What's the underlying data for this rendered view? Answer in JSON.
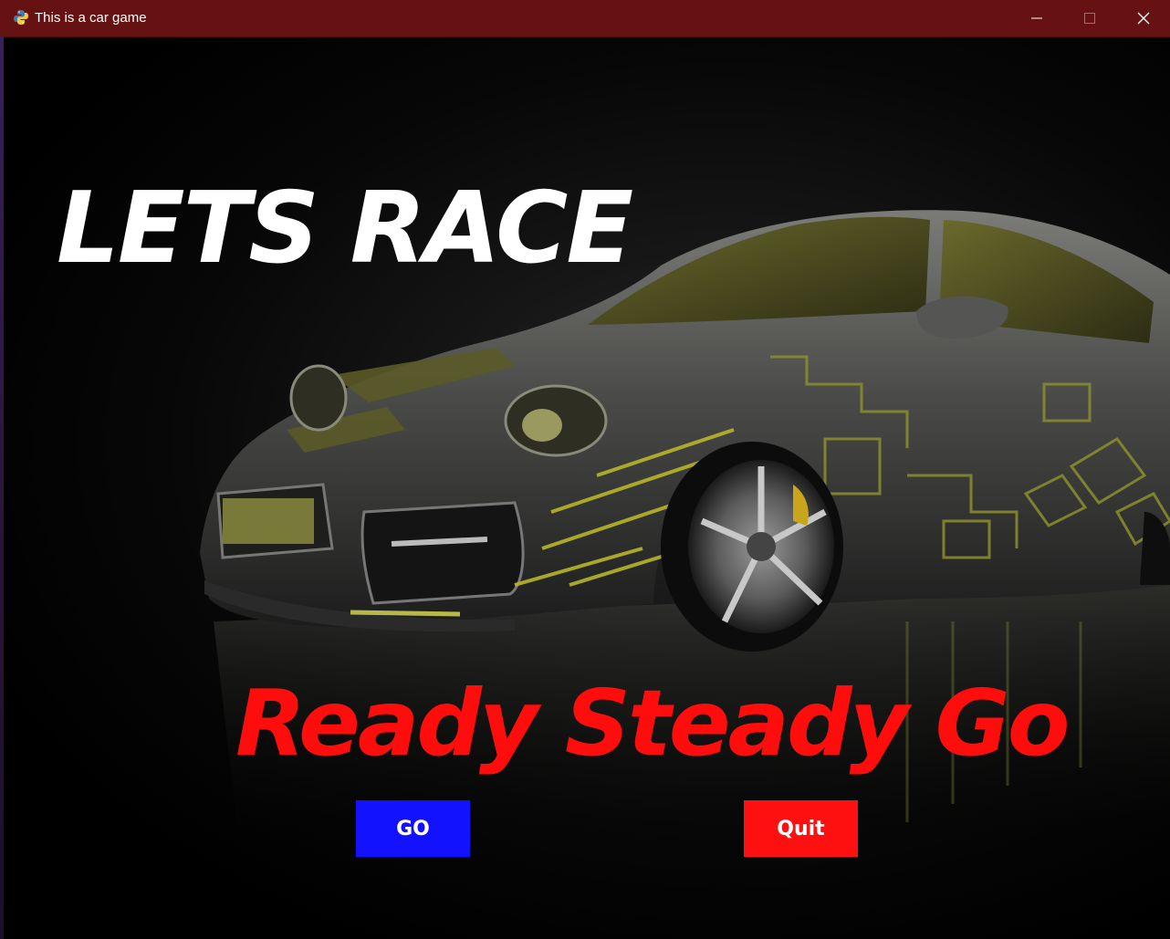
{
  "window": {
    "title": "This is a car game",
    "titlebar_color": "#661212",
    "app_icon": "python-icon",
    "controls": [
      "minimize-icon",
      "maximize-icon",
      "close-icon"
    ]
  },
  "game": {
    "headline": "LETS RACE",
    "headline_color": "#ffffff",
    "tagline": "Ready Steady Go",
    "tagline_color": "#ff0d0d",
    "buttons": [
      {
        "label": "GO",
        "color": "#1212ff"
      },
      {
        "label": "Quit",
        "color": "#ff1010"
      }
    ]
  }
}
